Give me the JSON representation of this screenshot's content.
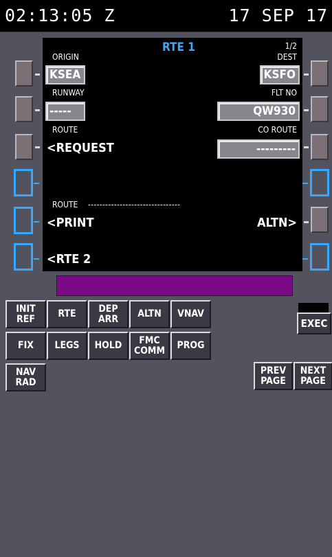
{
  "header": {
    "clock": "02:13:05 Z",
    "date": "17 SEP 17"
  },
  "screen": {
    "title": "RTE 1",
    "page": "1/2",
    "origin_label": "ORIGIN",
    "origin": "KSEA",
    "dest_label": "DEST",
    "dest": "KSFO",
    "runway_label": "RUNWAY",
    "runway": "-----",
    "flt_label": "FLT NO",
    "flt": "QW930",
    "route_label": "ROUTE",
    "route_request": "<REQUEST",
    "coroute_label": "CO ROUTE",
    "coroute": "---------",
    "route2_label": "ROUTE",
    "route2_dashes": "--------------------------------",
    "print": "<PRINT",
    "altn": "ALTN>",
    "rte2": "<RTE 2"
  },
  "keys": [
    [
      "INIT\nREF",
      "RTE",
      "DEP\nARR",
      "ALTN",
      "VNAV"
    ],
    [
      "FIX",
      "LEGS",
      "HOLD",
      "FMC\nCOMM",
      "PROG"
    ],
    [
      "NAV\nRAD"
    ]
  ],
  "page_keys": [
    "PREV\nPAGE",
    "NEXT\nPAGE"
  ],
  "exec": "EXEC",
  "colors": {
    "background": "#53525f",
    "screen": "#000000",
    "title": "#39a8ff",
    "scratchpad": "#7b0a86",
    "lsk_blue": "#36a8ff"
  }
}
